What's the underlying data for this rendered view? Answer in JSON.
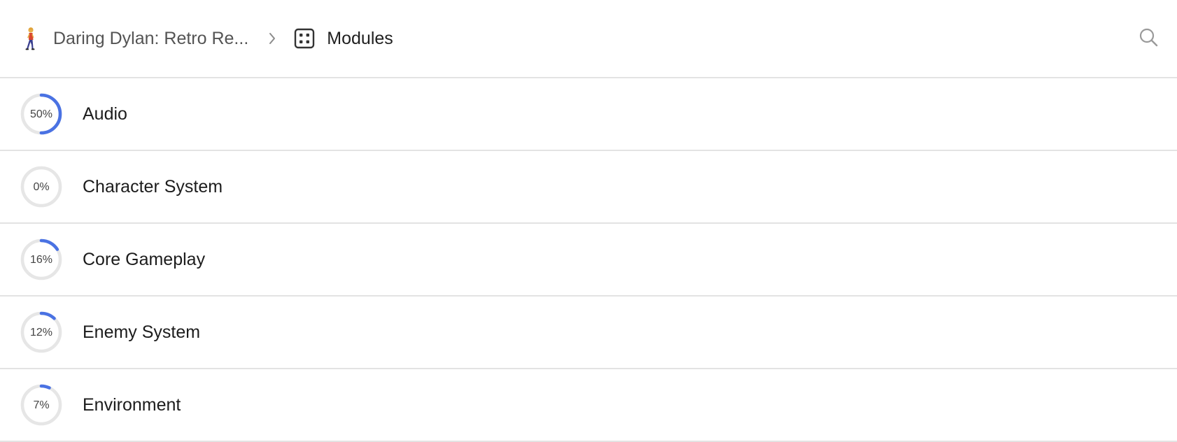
{
  "breadcrumb": {
    "project_icon": "person-walking-emoji",
    "project_name": "Daring Dylan: Retro Re...",
    "separator_icon": "chevron-right-icon",
    "current_icon": "modules-icon",
    "current_label": "Modules"
  },
  "search": {
    "icon": "search-icon"
  },
  "colors": {
    "progress": "#4a72e3",
    "track": "#e6e6e6",
    "divider": "#e3e3e3"
  },
  "modules": [
    {
      "name": "Audio",
      "progress_label": "50%",
      "progress": 0.5
    },
    {
      "name": "Character System",
      "progress_label": "0%",
      "progress": 0.0
    },
    {
      "name": "Core Gameplay",
      "progress_label": "16%",
      "progress": 0.16
    },
    {
      "name": "Enemy System",
      "progress_label": "12%",
      "progress": 0.12
    },
    {
      "name": "Environment",
      "progress_label": "7%",
      "progress": 0.07
    }
  ]
}
